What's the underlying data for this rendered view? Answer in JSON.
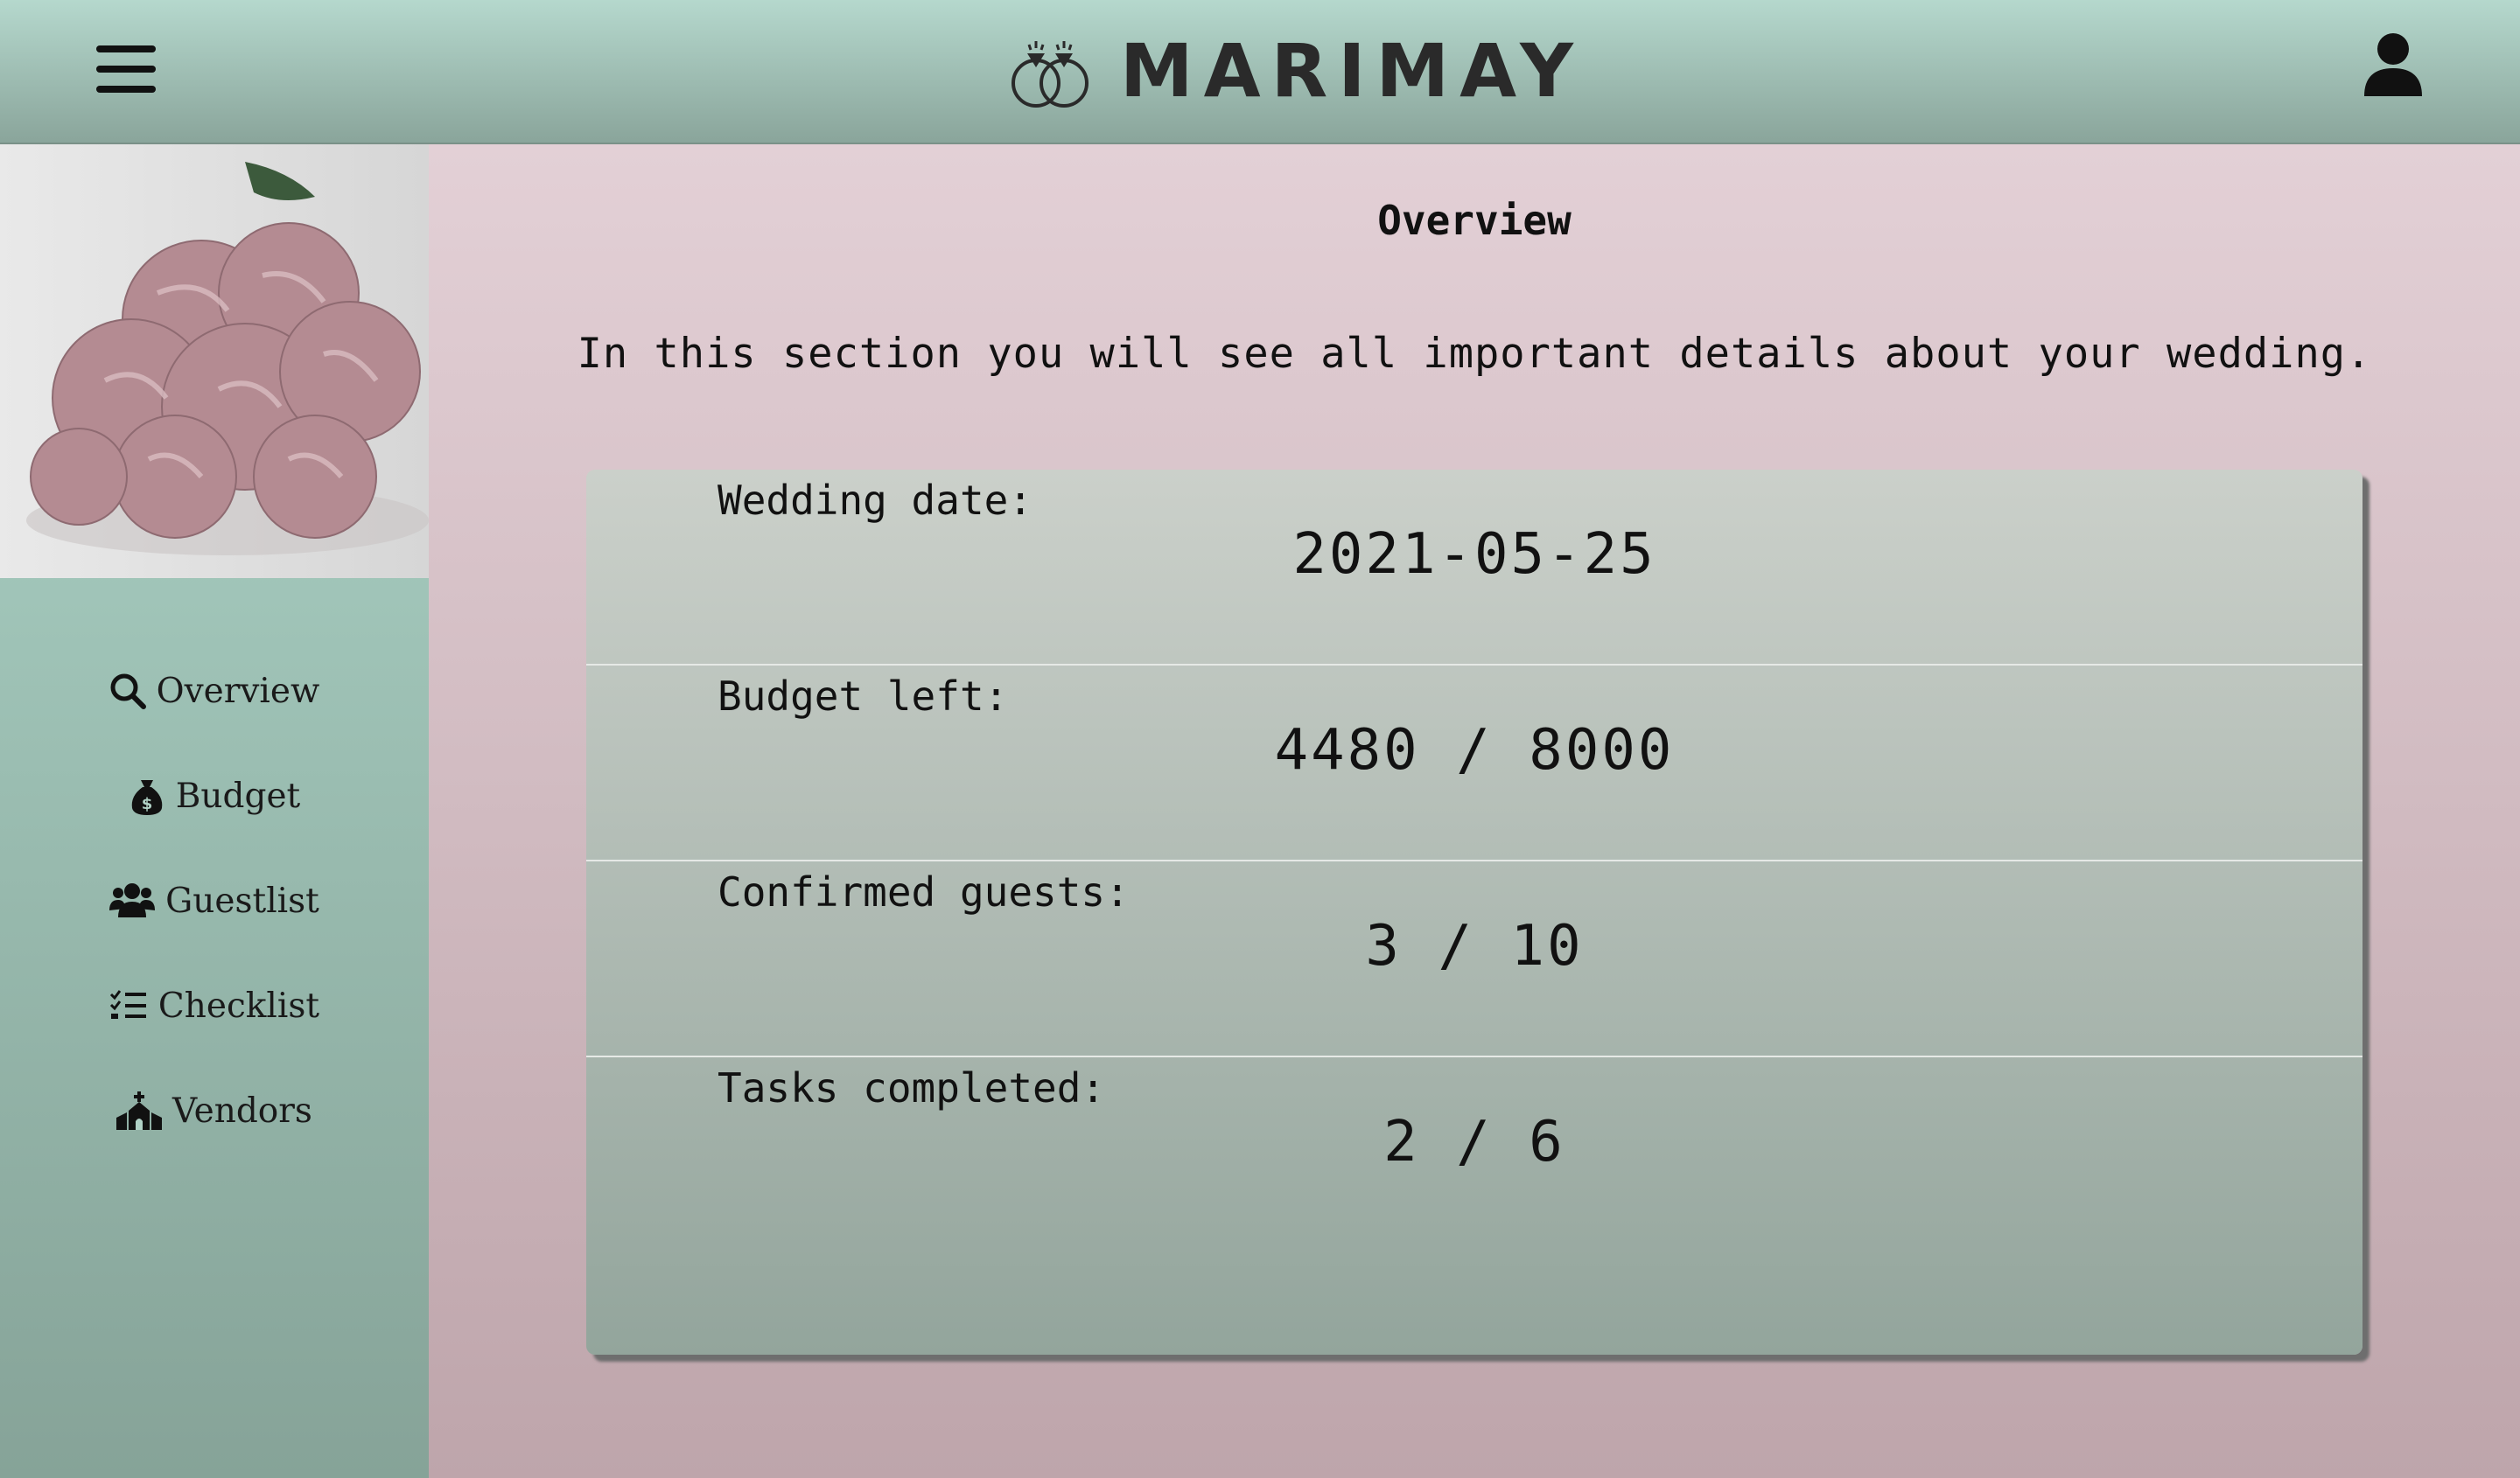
{
  "header": {
    "brand": "MARIMAY",
    "menu_icon": "hamburger-menu-icon",
    "logo_icon": "wedding-rings-icon",
    "user_icon": "user-account-icon"
  },
  "sidebar": {
    "image": "pink-hydrangea-flowers-photo",
    "items": [
      {
        "label": "Overview",
        "icon": "search-icon"
      },
      {
        "label": "Budget",
        "icon": "money-bag-icon"
      },
      {
        "label": "Guestlist",
        "icon": "users-icon"
      },
      {
        "label": "Checklist",
        "icon": "checklist-icon"
      },
      {
        "label": "Vendors",
        "icon": "church-icon"
      }
    ]
  },
  "main": {
    "title": "Overview",
    "subtitle": "In this section you will see all important details about your wedding.",
    "stats": [
      {
        "label": "Wedding date:",
        "value": "2021-05-25"
      },
      {
        "label": "Budget left:",
        "value": "4480 / 8000"
      },
      {
        "label": "Confirmed guests:",
        "value": "3 / 10"
      },
      {
        "label": "Tasks completed:",
        "value": "2 / 6"
      }
    ]
  },
  "colors": {
    "header_top": "#b5d8cd",
    "sidebar": "#add5c8",
    "main_bg": "#e3d0d6",
    "card": "#cbd0ca"
  }
}
